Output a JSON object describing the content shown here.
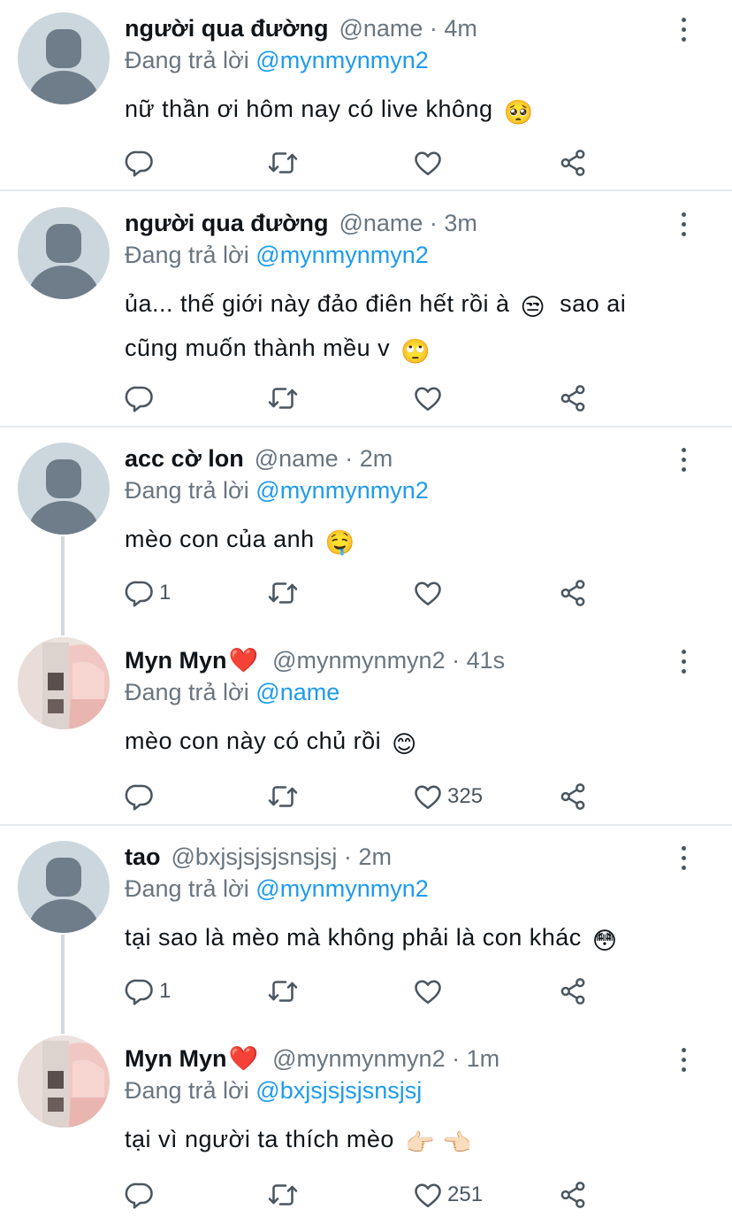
{
  "colors": {
    "link": "#1d9bf0",
    "muted": "#69757f",
    "text": "#0f1419",
    "divider": "#e7eaed",
    "icon": "#4a5660"
  },
  "replying_to_label": "Đang trả lời",
  "tweets": [
    {
      "name": "người qua đường",
      "heart": "",
      "handle": "@name · 4m",
      "reply_to": "@mynmynmyn2",
      "text": "nữ thần ơi hôm nay có live không",
      "emoji": "🥺",
      "text2": "",
      "emoji2": "",
      "reply_count": "",
      "like_count": "",
      "avatar": "default"
    },
    {
      "name": "người qua đường",
      "heart": "",
      "handle": "@name · 3m",
      "reply_to": "@mynmynmyn2",
      "text": "ủa... thế giới này đảo điên hết rồi à",
      "emoji": "😒",
      "text2": "sao ai cũng muốn thành mều v",
      "emoji2": "🙄",
      "reply_count": "",
      "like_count": "",
      "avatar": "default"
    },
    {
      "name": "acc cờ lon",
      "heart": "",
      "handle": "@name · 2m",
      "reply_to": "@mynmynmyn2",
      "text": "mèo con của anh",
      "emoji": "🤤",
      "text2": "",
      "emoji2": "",
      "reply_count": "1",
      "like_count": "",
      "avatar": "default"
    },
    {
      "name": "Myn Myn",
      "heart": "❤️",
      "handle": "@mynmynmyn2 · 41s",
      "reply_to": "@name",
      "text": "mèo con này có chủ rồi",
      "emoji": "😊",
      "text2": "",
      "emoji2": "",
      "reply_count": "",
      "like_count": "325",
      "avatar": "photo"
    },
    {
      "name": "tao",
      "heart": "",
      "handle": "@bxjsjsjsjsnsjsj · 2m",
      "reply_to": "@mynmynmyn2",
      "text": "tại sao là mèo mà không phải là con khác",
      "emoji": "😳",
      "text2": "",
      "emoji2": "",
      "reply_count": "1",
      "like_count": "",
      "avatar": "default"
    },
    {
      "name": "Myn Myn",
      "heart": "❤️",
      "handle": "@mynmynmyn2 · 1m",
      "reply_to": "@bxjsjsjsjsnsjsj",
      "text": "tại vì người ta thích mèo",
      "emoji": "👉🏻 👈🏻",
      "text2": "",
      "emoji2": "",
      "reply_count": "",
      "like_count": "251",
      "avatar": "photo"
    }
  ]
}
